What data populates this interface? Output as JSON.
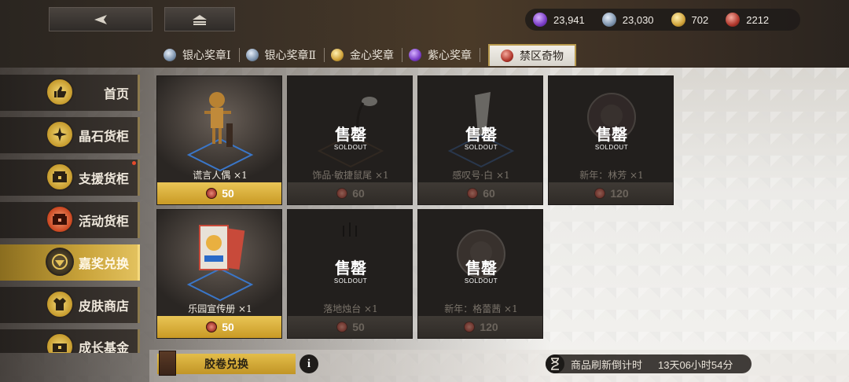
{
  "currencies": [
    {
      "icon": "purple-gem-icon",
      "value": "23,941",
      "color": "#8a4fd0"
    },
    {
      "icon": "silver-gem-icon",
      "value": "23,030",
      "color": "#8aa0b8"
    },
    {
      "icon": "gold-gem-icon",
      "value": "702",
      "color": "#d6b04a"
    },
    {
      "icon": "red-coin-icon",
      "value": "2212",
      "color": "#b33a30"
    }
  ],
  "tabs": [
    {
      "label": "银心奖章Ⅰ",
      "icon": "silver-heart-icon",
      "color": "#8aa0b8"
    },
    {
      "label": "银心奖章Ⅱ",
      "icon": "silver-heart-icon",
      "color": "#8aa0b8"
    },
    {
      "label": "金心奖章",
      "icon": "gold-heart-icon",
      "color": "#d6b04a"
    },
    {
      "label": "紫心奖章",
      "icon": "purple-heart-icon",
      "color": "#8a4fd0"
    },
    {
      "label": "禁区奇物",
      "icon": "red-coin-icon",
      "color": "#b33a30",
      "active": true
    }
  ],
  "sidebar": [
    {
      "label": "首页",
      "icon": "thumbs-up-icon"
    },
    {
      "label": "晶石货柜",
      "icon": "crystal-icon"
    },
    {
      "label": "支援货柜",
      "icon": "support-box-icon"
    },
    {
      "label": "活动货柜",
      "icon": "event-box-icon"
    },
    {
      "label": "嘉奖兑换",
      "icon": "emblem-icon",
      "active": true
    },
    {
      "label": "皮肤商店",
      "icon": "outfit-icon"
    },
    {
      "label": "成长基金",
      "icon": "fund-icon"
    }
  ],
  "sold_out": {
    "main": "售罄",
    "sub": "SOLDOUT"
  },
  "items": [
    {
      "name": "谎言人偶 ×1",
      "price": "50",
      "sold": false
    },
    {
      "name": "饰品·敏捷鼠尾 ×1",
      "price": "60",
      "sold": true
    },
    {
      "name": "感叹号·白 ×1",
      "price": "60",
      "sold": true
    },
    {
      "name": "新年：林芳 ×1",
      "price": "120",
      "sold": true
    },
    {
      "name": "乐园宣传册 ×1",
      "price": "50",
      "sold": false
    },
    {
      "name": "落地烛台 ×1",
      "price": "50",
      "sold": true
    },
    {
      "name": "新年：格蕾茜 ×1",
      "price": "120",
      "sold": true
    }
  ],
  "bottom": {
    "film_exchange": "胶卷兑换",
    "info": "i",
    "refresh_label": "商品刷新倒计时",
    "refresh_timer": "13天06小时54分"
  }
}
